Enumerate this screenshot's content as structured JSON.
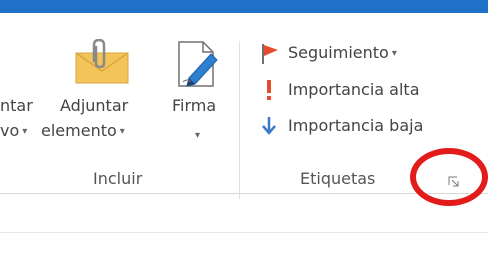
{
  "colors": {
    "title_bar": "#1f71c8",
    "ribbon_text": "#444444",
    "group_label": "#555555",
    "envelope": "#f2c45a",
    "flag": "#e74c2e",
    "importance_high": "#e54b2c",
    "importance_low": "#3a79c7",
    "highlight_circle": "#e21b1b"
  },
  "ribbon": {
    "incluir": {
      "label": "Incluir",
      "adjuntar_archivo": {
        "line1": "ntar",
        "line2": "vo",
        "dropdown": "▾",
        "icon": "paperclip-doc-icon"
      },
      "adjuntar_elemento": {
        "line1": "Adjuntar",
        "line2": "elemento",
        "dropdown": "▾",
        "icon": "envelope-paperclip-icon"
      },
      "firma": {
        "line1": "Firma",
        "dropdown": "▾",
        "icon": "signature-pen-icon"
      }
    },
    "etiquetas": {
      "label": "Etiquetas",
      "seguimiento": {
        "label": "Seguimiento",
        "dropdown": "▾",
        "icon": "flag-icon"
      },
      "importancia_alta": {
        "label": "Importancia alta",
        "icon": "exclamation-icon"
      },
      "importancia_baja": {
        "label": "Importancia baja",
        "icon": "down-arrow-icon"
      },
      "launcher_icon": "dialog-launcher-icon"
    }
  }
}
